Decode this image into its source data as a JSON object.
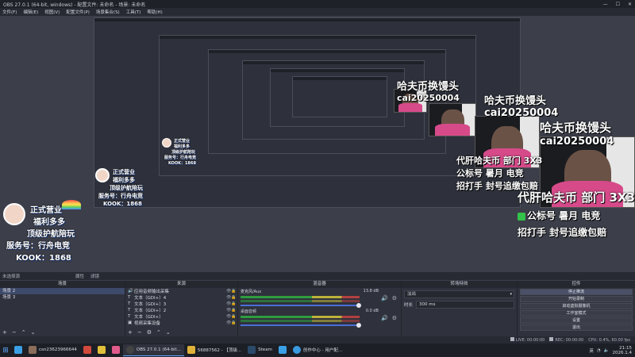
{
  "window": {
    "title": "OBS 27.0.1 (64-bit, windows) - 配置文件: 未命名 - 场景: 未命名",
    "controls": [
      "—",
      "☐",
      "✕"
    ]
  },
  "menu": [
    "文件(F)",
    "编辑(E)",
    "视图(V)",
    "配置文件(P)",
    "场景集合(S)",
    "工具(T)",
    "帮助(H)"
  ],
  "preview": {
    "overlay_mid": {
      "line1": "哈夫币换馒头",
      "line2": "cai20250004",
      "line3": "代肝哈夫币 部门 3X3",
      "line4": "公标号 暑月 电竞",
      "line5": "招打手 封号追缴包赔"
    },
    "overlay_right": {
      "line1": "哈夫币换馒头",
      "line2": "cai20250004",
      "line3": "代肝哈夫币 部门 3X3",
      "line4": "公标号 暑月 电竞",
      "line5": "招打手 封号追缴包赔"
    },
    "sticker": {
      "line1": "正式营业",
      "line2": "福利多多",
      "line3": "顶级护航陪玩",
      "line4": "服务号：行舟电竞",
      "line5": "KOOK：1868"
    }
  },
  "statusline": {
    "label": "未选择源",
    "tab1": "属性",
    "tab2": "滤镜"
  },
  "scenes": {
    "header": "场景",
    "items": [
      "场景 2",
      "场景 3"
    ]
  },
  "sources": {
    "header": "来源",
    "items": [
      {
        "icon": "speaker-icon",
        "glyph": "🔊",
        "label": "应用音频输出采集"
      },
      {
        "icon": "text-icon",
        "glyph": "T",
        "label": "文本（GDI+）4"
      },
      {
        "icon": "text-icon",
        "glyph": "T",
        "label": "文本（GDI+）3"
      },
      {
        "icon": "text-icon",
        "glyph": "T",
        "label": "文本（GDI+）2"
      },
      {
        "icon": "text-icon",
        "glyph": "T",
        "label": "文本（GDI+）"
      },
      {
        "icon": "camera-icon",
        "glyph": "▣",
        "label": "视频采集设备"
      }
    ]
  },
  "mixer": {
    "header": "混音器",
    "channels": [
      {
        "name": "麦克风/Aux",
        "db": "13.8 dB"
      },
      {
        "name": "桌面音频",
        "db": "0.0 dB"
      }
    ]
  },
  "transitions": {
    "header": "转场特效",
    "selected": "淡出",
    "duration_label": "时长",
    "duration_value": "300 ms"
  },
  "controls": {
    "header": "控件",
    "buttons": [
      "停止推流",
      "开始录制",
      "启动虚拟摄像机",
      "工作室模式",
      "设置",
      "退出"
    ]
  },
  "appstatus": {
    "live": "LIVE: 00:00:00",
    "rec": "REC: 00:00:00",
    "cpu": "CPU: 0.4%, 60.00 fps"
  },
  "taskbar": {
    "start_glyph": "⊞",
    "items": [
      {
        "label": "",
        "color": "#3aa0e6"
      },
      {
        "label": "csn23623966644",
        "color": "#8a6d5a"
      },
      {
        "label": "",
        "color": "#d24a3c"
      },
      {
        "label": "",
        "color": "#e0c03a"
      },
      {
        "label": "",
        "color": "#e05a8a"
      },
      {
        "label": "OBS 27.0.1 (64-bit...",
        "color": "#444"
      },
      {
        "label": "56887562 - 【顶级...",
        "color": "#e0b23a"
      },
      {
        "label": "Steam",
        "color": "#2a4a6a"
      },
      {
        "label": "",
        "color": "#3aa0e6"
      },
      {
        "label": "创作中心 - 用户配...",
        "color": "#3a9ae0"
      }
    ],
    "tray": {
      "lang": "英",
      "time": "21:15",
      "date": "2026.1.4"
    }
  }
}
